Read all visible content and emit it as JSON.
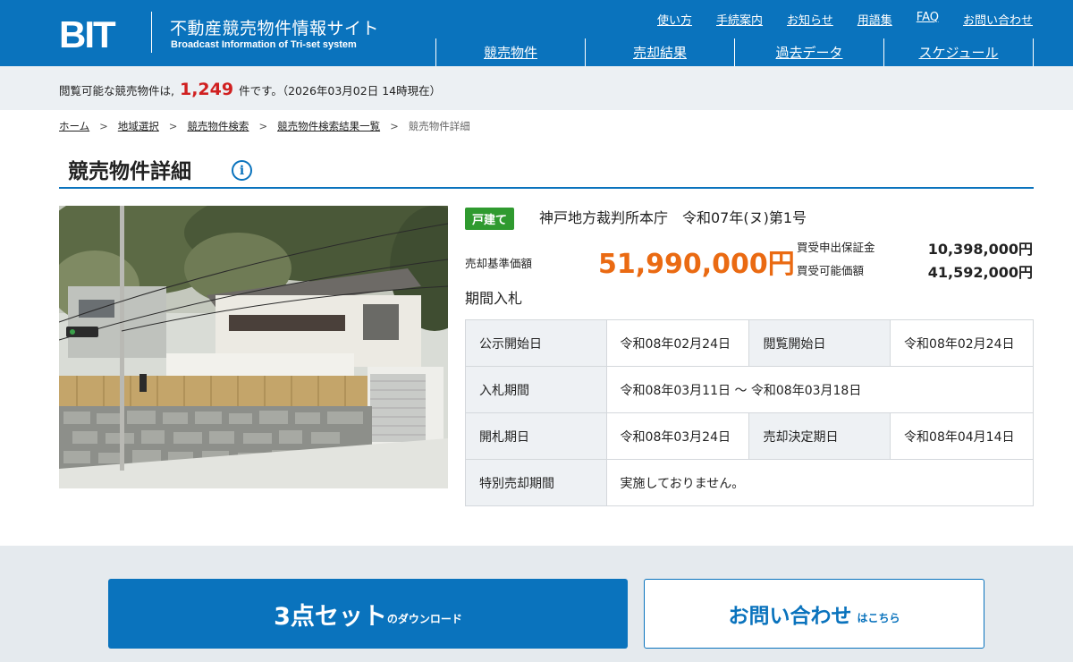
{
  "header": {
    "logo_text": "BIT",
    "site_title": "不動産競売物件情報サイト",
    "site_subtitle": "Broadcast Information of Tri-set system",
    "util_links": [
      "使い方",
      "手続案内",
      "お知らせ",
      "用語集",
      "FAQ",
      "お問い合わせ"
    ],
    "main_nav": [
      "競売物件",
      "売却結果",
      "過去データ",
      "スケジュール"
    ]
  },
  "count_bar": {
    "prefix": "閲覧可能な競売物件は,",
    "count": "1,249",
    "suffix": "件です。（2026年03月02日 14時現在）"
  },
  "breadcrumb": {
    "items": [
      "ホーム",
      "地域選択",
      "競売物件検索",
      "競売物件検索結果一覧"
    ],
    "current": "競売物件詳細"
  },
  "page": {
    "title": "競売物件詳細",
    "info_icon": "i"
  },
  "property": {
    "type_badge": "戸建て",
    "court_case": "神戸地方裁判所本庁　令和07年(ヌ)第1号",
    "base_price_label": "売却基準価額",
    "base_price": "51,990,000円",
    "deposit_label": "買受申出保証金",
    "deposit_value": "10,398,000円",
    "min_price_label": "買受可能価額",
    "min_price_value": "41,592,000円",
    "bid_method": "期間入札"
  },
  "schedule": {
    "announce_label": "公示開始日",
    "announce_value": "令和08年02月24日",
    "view_label": "閲覧開始日",
    "view_value": "令和08年02月24日",
    "bid_period_label": "入札期間",
    "bid_period_value": "令和08年03月11日 ～ 令和08年03月18日",
    "opening_label": "開札期日",
    "opening_value": "令和08年03月24日",
    "decision_label": "売却決定期日",
    "decision_value": "令和08年04月14日",
    "special_label": "特別売却期間",
    "special_value": "実施しておりません。"
  },
  "buttons": {
    "download_main": "3点セット",
    "download_sub": "のダウンロード",
    "contact_main": "お問い合わせ",
    "contact_sub": "はこちら"
  },
  "colors": {
    "brand_blue": "#0a73bd",
    "price_orange": "#ea6a12",
    "count_red": "#d02020",
    "badge_green": "#2f9a2f"
  }
}
